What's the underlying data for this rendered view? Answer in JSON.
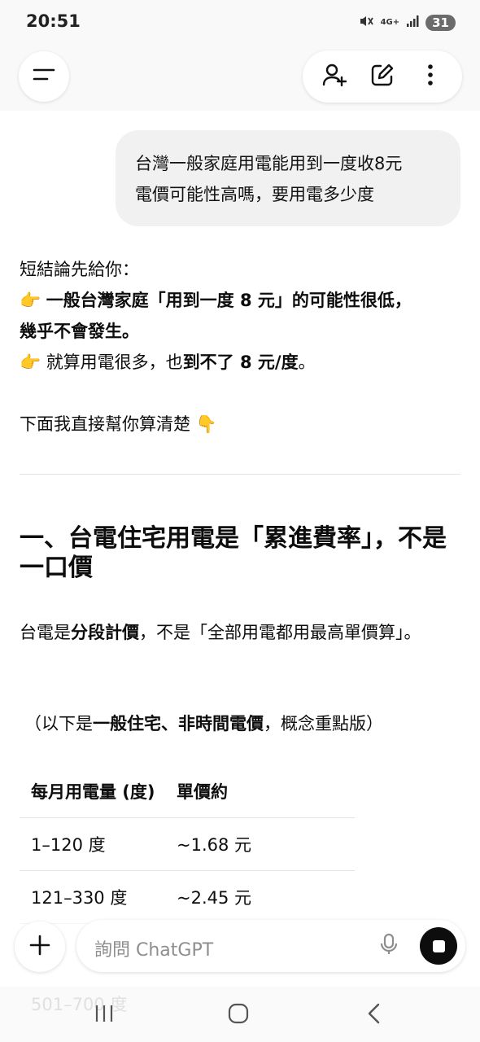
{
  "status_bar": {
    "time": "20:51",
    "network": "4G+",
    "battery": "31"
  },
  "header": {
    "icons": [
      "menu-icon",
      "add-person-icon",
      "edit-icon",
      "more-icon"
    ]
  },
  "user_message": {
    "lines": [
      "台灣一般家庭用電能用到一度收8元",
      "電價可能性高嗎，要用電多少度"
    ]
  },
  "answer": {
    "intro": "短結論先給你：",
    "point1_bold_a": "一般台灣家庭「用到一度 8 元」的可能性很低，",
    "point1_bold_b": "幾乎不會發生。",
    "point2_text": "就算用電很多，也",
    "point2_bold": "到不了 8 元/度",
    "point2_end": "。",
    "calc_line": "下面我直接幫你算清楚",
    "heading": "一、台電住宅用電是「累進費率」，不是一口價",
    "para_a": "台電是",
    "para_bold": "分段計價",
    "para_b": "，不是「全部用電都用最高單價算」。",
    "note_a": "（以下是",
    "note_bold": "一般住宅、非時間電價",
    "note_b": "，概念重點版）"
  },
  "table": {
    "headers": [
      "每月用電量 (度)",
      "單價約"
    ],
    "rows": [
      [
        "1–120 度",
        "~1.68 元"
      ],
      [
        "121–330 度",
        "~2.45 元"
      ]
    ],
    "faded_row": "501–700 度"
  },
  "composer": {
    "placeholder": "詢問 ChatGPT"
  },
  "colors": {
    "accent": "#0d0d0d",
    "bubble": "#f1f1f1",
    "background": "#ffffff"
  }
}
